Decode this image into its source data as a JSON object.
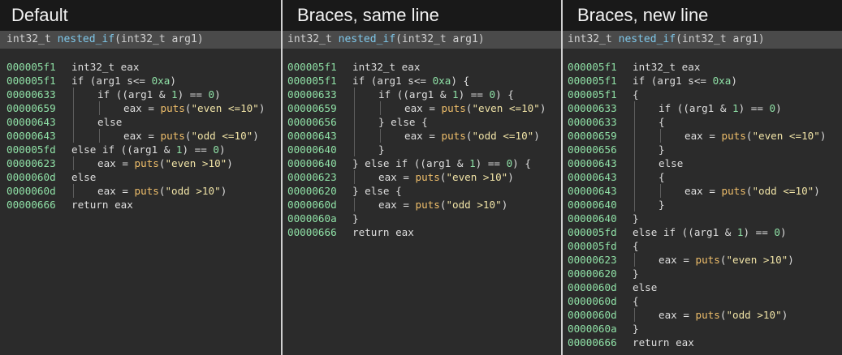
{
  "panels": [
    {
      "title": "Default",
      "signature": {
        "ret": "int32_t ",
        "name": "nested_if",
        "params": "(int32_t ",
        "arg": "arg1",
        "close": ")"
      },
      "lines": [
        {
          "addr": "000005f1",
          "depth": 0,
          "parts": [
            [
              "int32_t eax",
              ""
            ]
          ]
        },
        {
          "addr": "000005f1",
          "depth": 0,
          "parts": [
            [
              "if (arg1 s<= ",
              ""
            ],
            [
              "0xa",
              "n"
            ],
            [
              ")",
              ""
            ]
          ]
        },
        {
          "addr": "00000633",
          "depth": 1,
          "parts": [
            [
              "if ((arg1 & ",
              ""
            ],
            [
              "1",
              "n"
            ],
            [
              ") == ",
              ""
            ],
            [
              "0",
              "n"
            ],
            [
              ")",
              ""
            ]
          ]
        },
        {
          "addr": "00000659",
          "depth": 2,
          "parts": [
            [
              "eax = ",
              ""
            ],
            [
              "puts",
              "f"
            ],
            [
              "(",
              ""
            ],
            [
              "\"even <=10\"",
              "s"
            ],
            [
              ")",
              ""
            ]
          ]
        },
        {
          "addr": "00000643",
          "depth": 1,
          "parts": [
            [
              "else",
              ""
            ]
          ]
        },
        {
          "addr": "00000643",
          "depth": 2,
          "parts": [
            [
              "eax = ",
              ""
            ],
            [
              "puts",
              "f"
            ],
            [
              "(",
              ""
            ],
            [
              "\"odd <=10\"",
              "s"
            ],
            [
              ")",
              ""
            ]
          ]
        },
        {
          "addr": "000005fd",
          "depth": 0,
          "parts": [
            [
              "else if ((arg1 & ",
              ""
            ],
            [
              "1",
              "n"
            ],
            [
              ") == ",
              ""
            ],
            [
              "0",
              "n"
            ],
            [
              ")",
              ""
            ]
          ]
        },
        {
          "addr": "00000623",
          "depth": 1,
          "parts": [
            [
              "eax = ",
              ""
            ],
            [
              "puts",
              "f"
            ],
            [
              "(",
              ""
            ],
            [
              "\"even >10\"",
              "s"
            ],
            [
              ")",
              ""
            ]
          ]
        },
        {
          "addr": "0000060d",
          "depth": 0,
          "parts": [
            [
              "else",
              ""
            ]
          ]
        },
        {
          "addr": "0000060d",
          "depth": 1,
          "parts": [
            [
              "eax = ",
              ""
            ],
            [
              "puts",
              "f"
            ],
            [
              "(",
              ""
            ],
            [
              "\"odd >10\"",
              "s"
            ],
            [
              ")",
              ""
            ]
          ]
        },
        {
          "addr": "00000666",
          "depth": 0,
          "parts": [
            [
              "return eax",
              ""
            ]
          ]
        }
      ]
    },
    {
      "title": "Braces, same line",
      "signature": {
        "ret": "int32_t ",
        "name": "nested_if",
        "params": "(int32_t ",
        "arg": "arg1",
        "close": ")"
      },
      "lines": [
        {
          "addr": "000005f1",
          "depth": 0,
          "parts": [
            [
              "int32_t eax",
              ""
            ]
          ]
        },
        {
          "addr": "000005f1",
          "depth": 0,
          "parts": [
            [
              "if (arg1 s<= ",
              ""
            ],
            [
              "0xa",
              "n"
            ],
            [
              ") {",
              ""
            ]
          ]
        },
        {
          "addr": "00000633",
          "depth": 1,
          "parts": [
            [
              "if ((arg1 & ",
              ""
            ],
            [
              "1",
              "n"
            ],
            [
              ") == ",
              ""
            ],
            [
              "0",
              "n"
            ],
            [
              ") {",
              ""
            ]
          ]
        },
        {
          "addr": "00000659",
          "depth": 2,
          "parts": [
            [
              "eax = ",
              ""
            ],
            [
              "puts",
              "f"
            ],
            [
              "(",
              ""
            ],
            [
              "\"even <=10\"",
              "s"
            ],
            [
              ")",
              ""
            ]
          ]
        },
        {
          "addr": "00000656",
          "depth": 1,
          "parts": [
            [
              "} else {",
              ""
            ]
          ]
        },
        {
          "addr": "00000643",
          "depth": 2,
          "parts": [
            [
              "eax = ",
              ""
            ],
            [
              "puts",
              "f"
            ],
            [
              "(",
              ""
            ],
            [
              "\"odd <=10\"",
              "s"
            ],
            [
              ")",
              ""
            ]
          ]
        },
        {
          "addr": "00000640",
          "depth": 1,
          "parts": [
            [
              "}",
              ""
            ]
          ]
        },
        {
          "addr": "00000640",
          "depth": 0,
          "parts": [
            [
              "} else if ((arg1 & ",
              ""
            ],
            [
              "1",
              "n"
            ],
            [
              ") == ",
              ""
            ],
            [
              "0",
              "n"
            ],
            [
              ") {",
              ""
            ]
          ]
        },
        {
          "addr": "00000623",
          "depth": 1,
          "parts": [
            [
              "eax = ",
              ""
            ],
            [
              "puts",
              "f"
            ],
            [
              "(",
              ""
            ],
            [
              "\"even >10\"",
              "s"
            ],
            [
              ")",
              ""
            ]
          ]
        },
        {
          "addr": "00000620",
          "depth": 0,
          "parts": [
            [
              "} else {",
              ""
            ]
          ]
        },
        {
          "addr": "0000060d",
          "depth": 1,
          "parts": [
            [
              "eax = ",
              ""
            ],
            [
              "puts",
              "f"
            ],
            [
              "(",
              ""
            ],
            [
              "\"odd >10\"",
              "s"
            ],
            [
              ")",
              ""
            ]
          ]
        },
        {
          "addr": "0000060a",
          "depth": 0,
          "parts": [
            [
              "}",
              ""
            ]
          ]
        },
        {
          "addr": "00000666",
          "depth": 0,
          "parts": [
            [
              "return eax",
              ""
            ]
          ]
        }
      ]
    },
    {
      "title": "Braces, new line",
      "signature": {
        "ret": "int32_t ",
        "name": "nested_if",
        "params": "(int32_t ",
        "arg": "arg1",
        "close": ")"
      },
      "lines": [
        {
          "addr": "000005f1",
          "depth": 0,
          "parts": [
            [
              "int32_t eax",
              ""
            ]
          ]
        },
        {
          "addr": "000005f1",
          "depth": 0,
          "parts": [
            [
              "if (arg1 s<= ",
              ""
            ],
            [
              "0xa",
              "n"
            ],
            [
              ")",
              ""
            ]
          ]
        },
        {
          "addr": "000005f1",
          "depth": 0,
          "parts": [
            [
              "{",
              ""
            ]
          ]
        },
        {
          "addr": "00000633",
          "depth": 1,
          "parts": [
            [
              "if ((arg1 & ",
              ""
            ],
            [
              "1",
              "n"
            ],
            [
              ") == ",
              ""
            ],
            [
              "0",
              "n"
            ],
            [
              ")",
              ""
            ]
          ]
        },
        {
          "addr": "00000633",
          "depth": 1,
          "parts": [
            [
              "{",
              ""
            ]
          ]
        },
        {
          "addr": "00000659",
          "depth": 2,
          "parts": [
            [
              "eax = ",
              ""
            ],
            [
              "puts",
              "f"
            ],
            [
              "(",
              ""
            ],
            [
              "\"even <=10\"",
              "s"
            ],
            [
              ")",
              ""
            ]
          ]
        },
        {
          "addr": "00000656",
          "depth": 1,
          "parts": [
            [
              "}",
              ""
            ]
          ]
        },
        {
          "addr": "00000643",
          "depth": 1,
          "parts": [
            [
              "else",
              ""
            ]
          ]
        },
        {
          "addr": "00000643",
          "depth": 1,
          "parts": [
            [
              "{",
              ""
            ]
          ]
        },
        {
          "addr": "00000643",
          "depth": 2,
          "parts": [
            [
              "eax = ",
              ""
            ],
            [
              "puts",
              "f"
            ],
            [
              "(",
              ""
            ],
            [
              "\"odd <=10\"",
              "s"
            ],
            [
              ")",
              ""
            ]
          ]
        },
        {
          "addr": "00000640",
          "depth": 1,
          "parts": [
            [
              "}",
              ""
            ]
          ]
        },
        {
          "addr": "00000640",
          "depth": 0,
          "parts": [
            [
              "}",
              ""
            ]
          ]
        },
        {
          "addr": "000005fd",
          "depth": 0,
          "parts": [
            [
              "else if ((arg1 & ",
              ""
            ],
            [
              "1",
              "n"
            ],
            [
              ") == ",
              ""
            ],
            [
              "0",
              "n"
            ],
            [
              ")",
              ""
            ]
          ]
        },
        {
          "addr": "000005fd",
          "depth": 0,
          "parts": [
            [
              "{",
              ""
            ]
          ]
        },
        {
          "addr": "00000623",
          "depth": 1,
          "parts": [
            [
              "eax = ",
              ""
            ],
            [
              "puts",
              "f"
            ],
            [
              "(",
              ""
            ],
            [
              "\"even >10\"",
              "s"
            ],
            [
              ")",
              ""
            ]
          ]
        },
        {
          "addr": "00000620",
          "depth": 0,
          "parts": [
            [
              "}",
              ""
            ]
          ]
        },
        {
          "addr": "0000060d",
          "depth": 0,
          "parts": [
            [
              "else",
              ""
            ]
          ]
        },
        {
          "addr": "0000060d",
          "depth": 0,
          "parts": [
            [
              "{",
              ""
            ]
          ]
        },
        {
          "addr": "0000060d",
          "depth": 1,
          "parts": [
            [
              "eax = ",
              ""
            ],
            [
              "puts",
              "f"
            ],
            [
              "(",
              ""
            ],
            [
              "\"odd >10\"",
              "s"
            ],
            [
              ")",
              ""
            ]
          ]
        },
        {
          "addr": "0000060a",
          "depth": 0,
          "parts": [
            [
              "}",
              ""
            ]
          ]
        },
        {
          "addr": "00000666",
          "depth": 0,
          "parts": [
            [
              "return eax",
              ""
            ]
          ]
        }
      ]
    }
  ]
}
